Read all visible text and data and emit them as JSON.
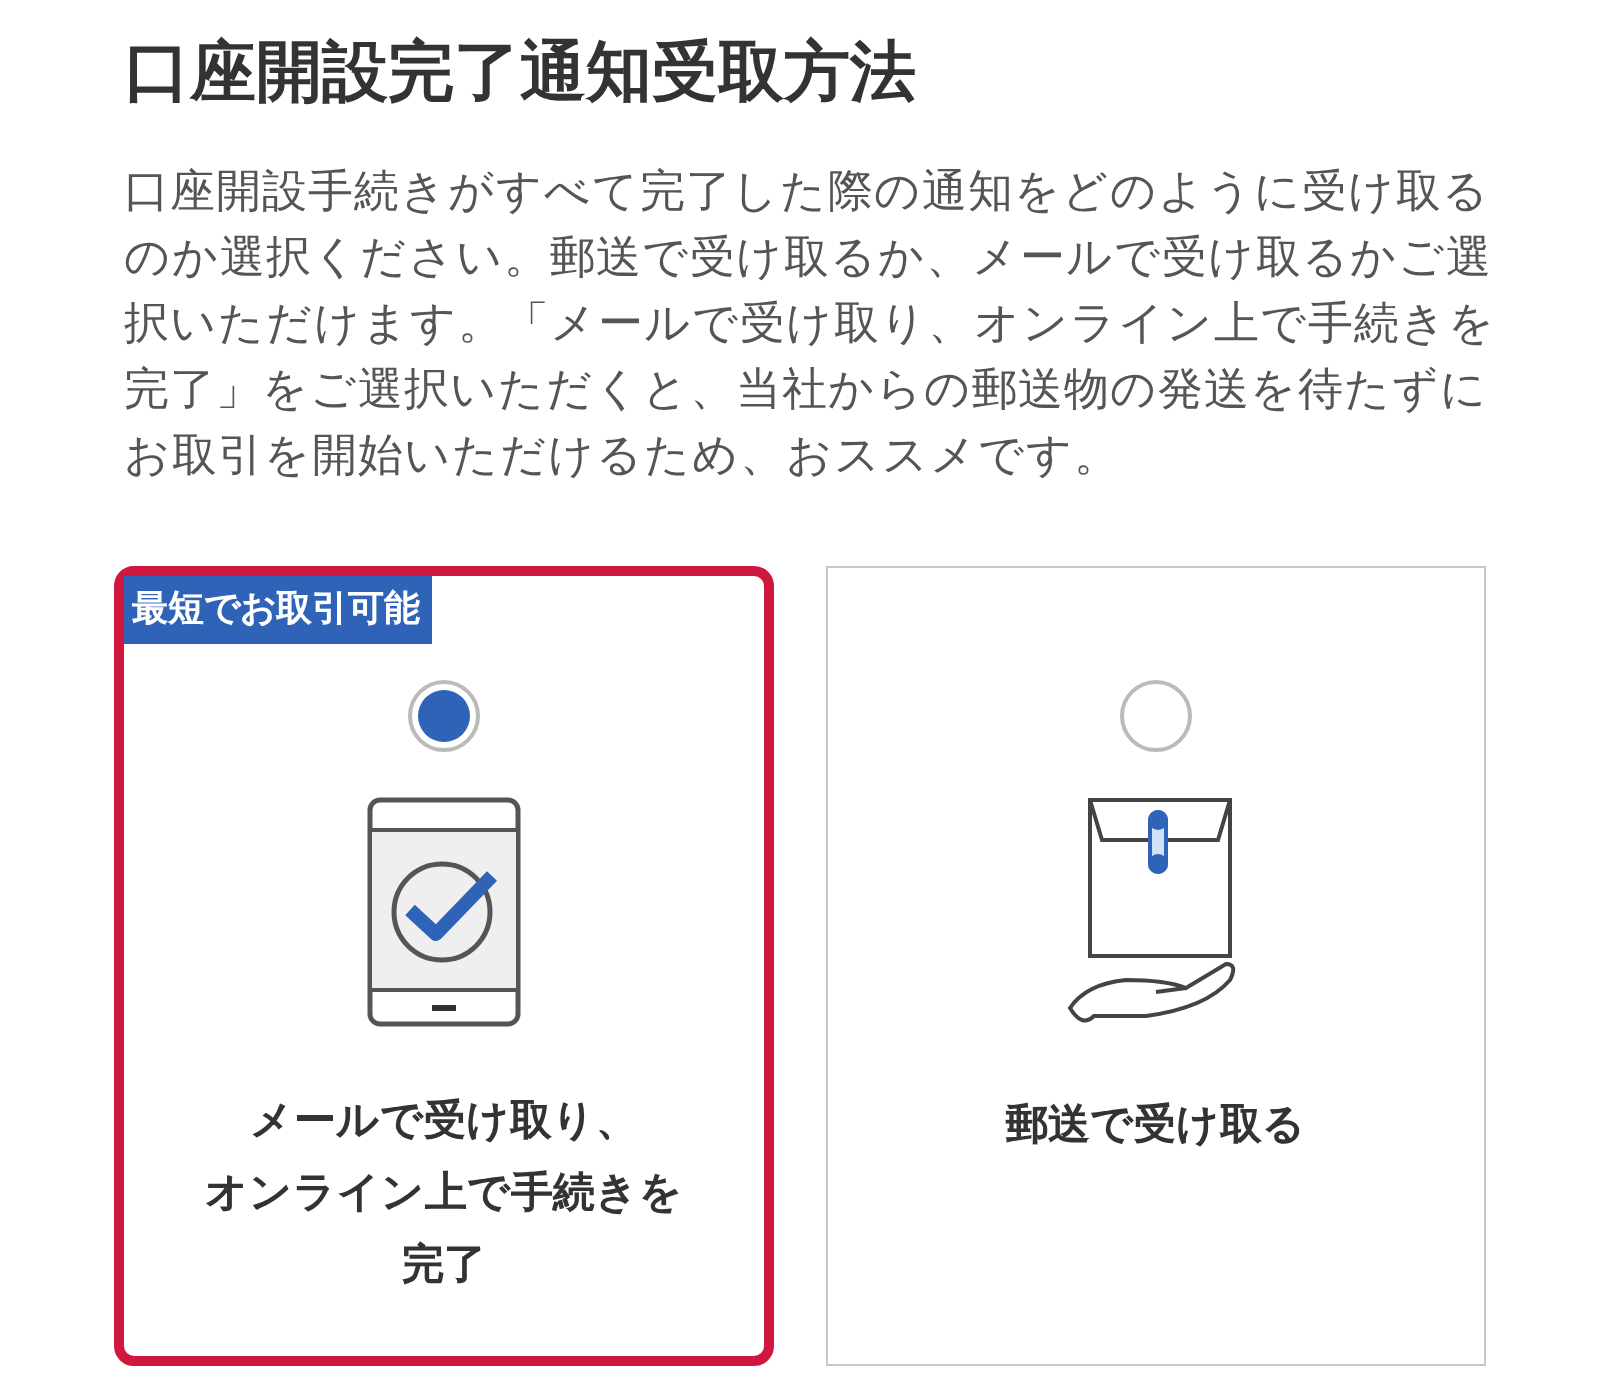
{
  "title": "口座開設完了通知受取方法",
  "description": "口座開設手続きがすべて完了した際の通知をどのように受け取るのか選択ください。郵送で受け取るか、メールで受け取るかご選択いただけます。「メールで受け取り、オンライン上で手続きを完了」をご選択いただくと、当社からの郵送物の発送を待たずにお取引を開始いただけるため、おススメです。",
  "options": [
    {
      "kind": "online",
      "selected": true,
      "badge": "最短でお取引可能",
      "label_lines": [
        "メールで受け取り、",
        "オンライン上で手続きを",
        "完了"
      ]
    },
    {
      "kind": "mail",
      "selected": false,
      "label_lines": [
        "郵送で受け取る"
      ]
    }
  ]
}
